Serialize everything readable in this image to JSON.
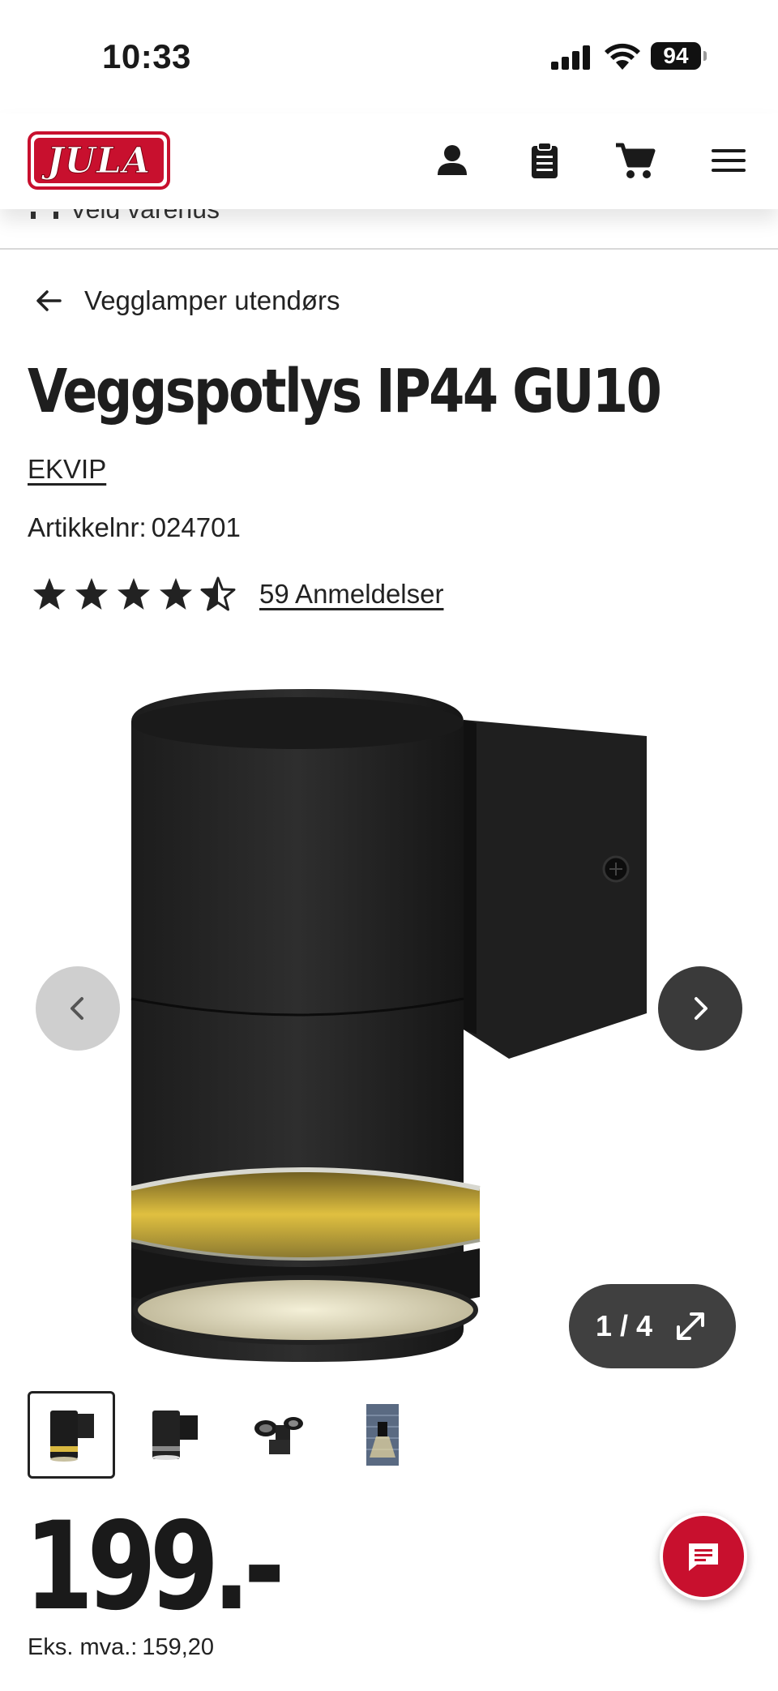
{
  "status_bar": {
    "time": "10:33",
    "battery": "94"
  },
  "header": {
    "logo_text": "JULA",
    "store_label": "Velg varehus"
  },
  "breadcrumb": {
    "label": "Vegglamper utendørs"
  },
  "product": {
    "title": "Veggspotlys IP44 GU10",
    "brand": "EKVIP",
    "article_label": "Artikkelnr:",
    "article_number": "024701",
    "rating": 4.5,
    "reviews_label": "59 Anmeldelser",
    "price": "199.-",
    "price_ex_label": "Eks. mva.:",
    "price_ex_value": "159,20"
  },
  "gallery": {
    "counter": "1 / 4",
    "current": 1,
    "total": 4
  },
  "colors": {
    "brand_red": "#c8102e",
    "text_dark": "#1a1a1a"
  },
  "icons": [
    "user-icon",
    "clipboard-icon",
    "cart-icon",
    "menu-icon",
    "arrow-left-icon",
    "star-icon",
    "chevron-left-icon",
    "chevron-right-icon",
    "expand-icon",
    "chat-icon"
  ]
}
